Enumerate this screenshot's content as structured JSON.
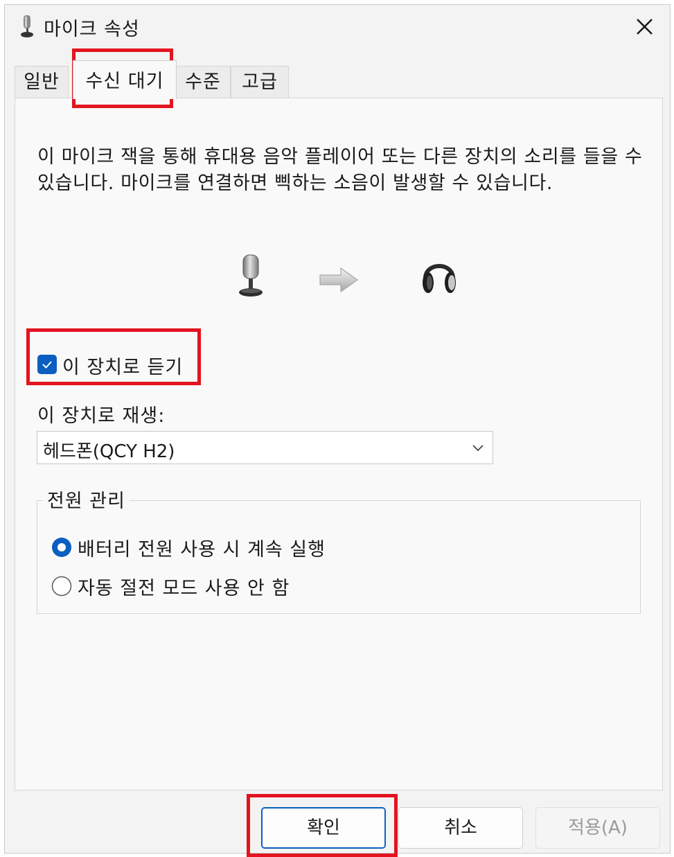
{
  "window": {
    "title": "마이크 속성",
    "close_icon": "close-icon"
  },
  "tabs": [
    {
      "label": "일반"
    },
    {
      "label": "수신 대기",
      "active": true
    },
    {
      "label": "수준"
    },
    {
      "label": "고급"
    }
  ],
  "listen": {
    "description": "이 마이크 잭을 통해 휴대용 음악 플레이어 또는 다른 장치의 소리를 들을 수 있습니다. 마이크를 연결하면 삑하는 소음이 발생할 수 있습니다.",
    "illustration_icons": [
      "microphone-icon",
      "arrow-right-icon",
      "headphones-icon"
    ],
    "checkbox_label": "이 장치로 듣기",
    "checkbox_checked": true,
    "playback_label": "이 장치로 재생:",
    "playback_device": "헤드폰(QCY H2)"
  },
  "power": {
    "title": "전원 관리",
    "options": [
      {
        "label": "배터리 전원 사용 시 계속 실행",
        "selected": true
      },
      {
        "label": "자동 절전 모드 사용 안 함",
        "selected": false
      }
    ]
  },
  "buttons": {
    "ok": "확인",
    "cancel": "취소",
    "apply": "적용(A)",
    "apply_enabled": false
  },
  "colors": {
    "accent": "#0a5fc0",
    "highlight": "#e3131f"
  }
}
